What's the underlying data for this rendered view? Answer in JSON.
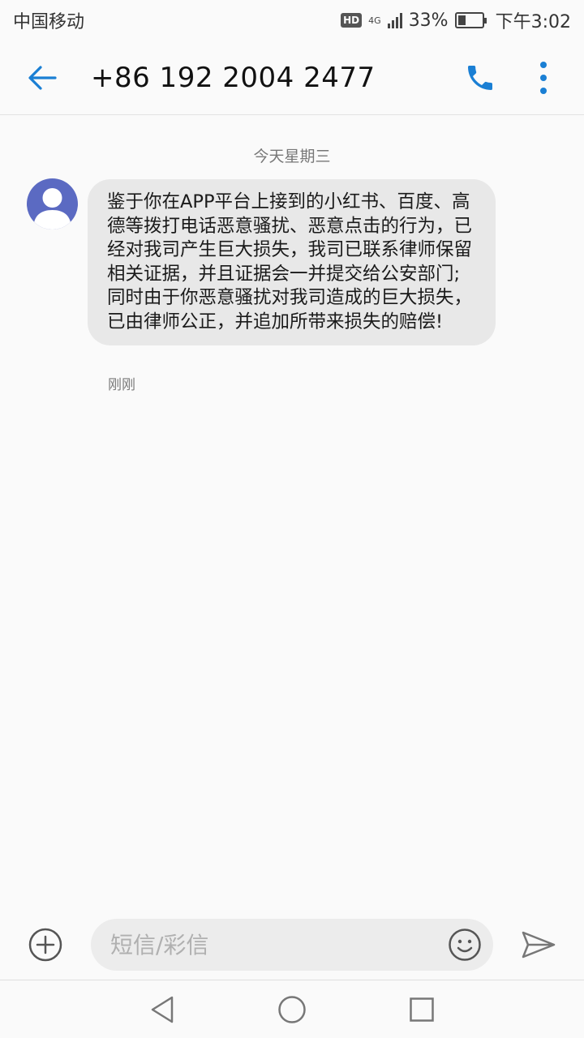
{
  "status_bar": {
    "carrier": "中国移动",
    "hd_label": "HD",
    "network": "4G",
    "battery": "33%",
    "battery_level": 0.33,
    "time": "下午3:02"
  },
  "header": {
    "title": "+86 192 2004 2477",
    "back_icon": "arrow-left-icon",
    "call_icon": "phone-icon",
    "more_icon": "more-vert-icon"
  },
  "conversation": {
    "date_divider": "今天星期三",
    "messages": [
      {
        "text": "鉴于你在APP平台上接到的小红书、百度、高德等拨打电话恶意骚扰、恶意点击的行为，已经对我司产生巨大损失，我司已联系律师保留相关证据，并且证据会一并提交给公安部门;同时由于你恶意骚扰对我司造成的巨大损失，已由律师公正，并追加所带来损失的赔偿!",
        "time": "刚刚"
      }
    ]
  },
  "composer": {
    "placeholder": "短信/彩信",
    "value": ""
  },
  "colors": {
    "accent": "#1a7fd4",
    "avatar_bg": "#5b6ac2",
    "bubble_bg": "#e8e8e8"
  }
}
